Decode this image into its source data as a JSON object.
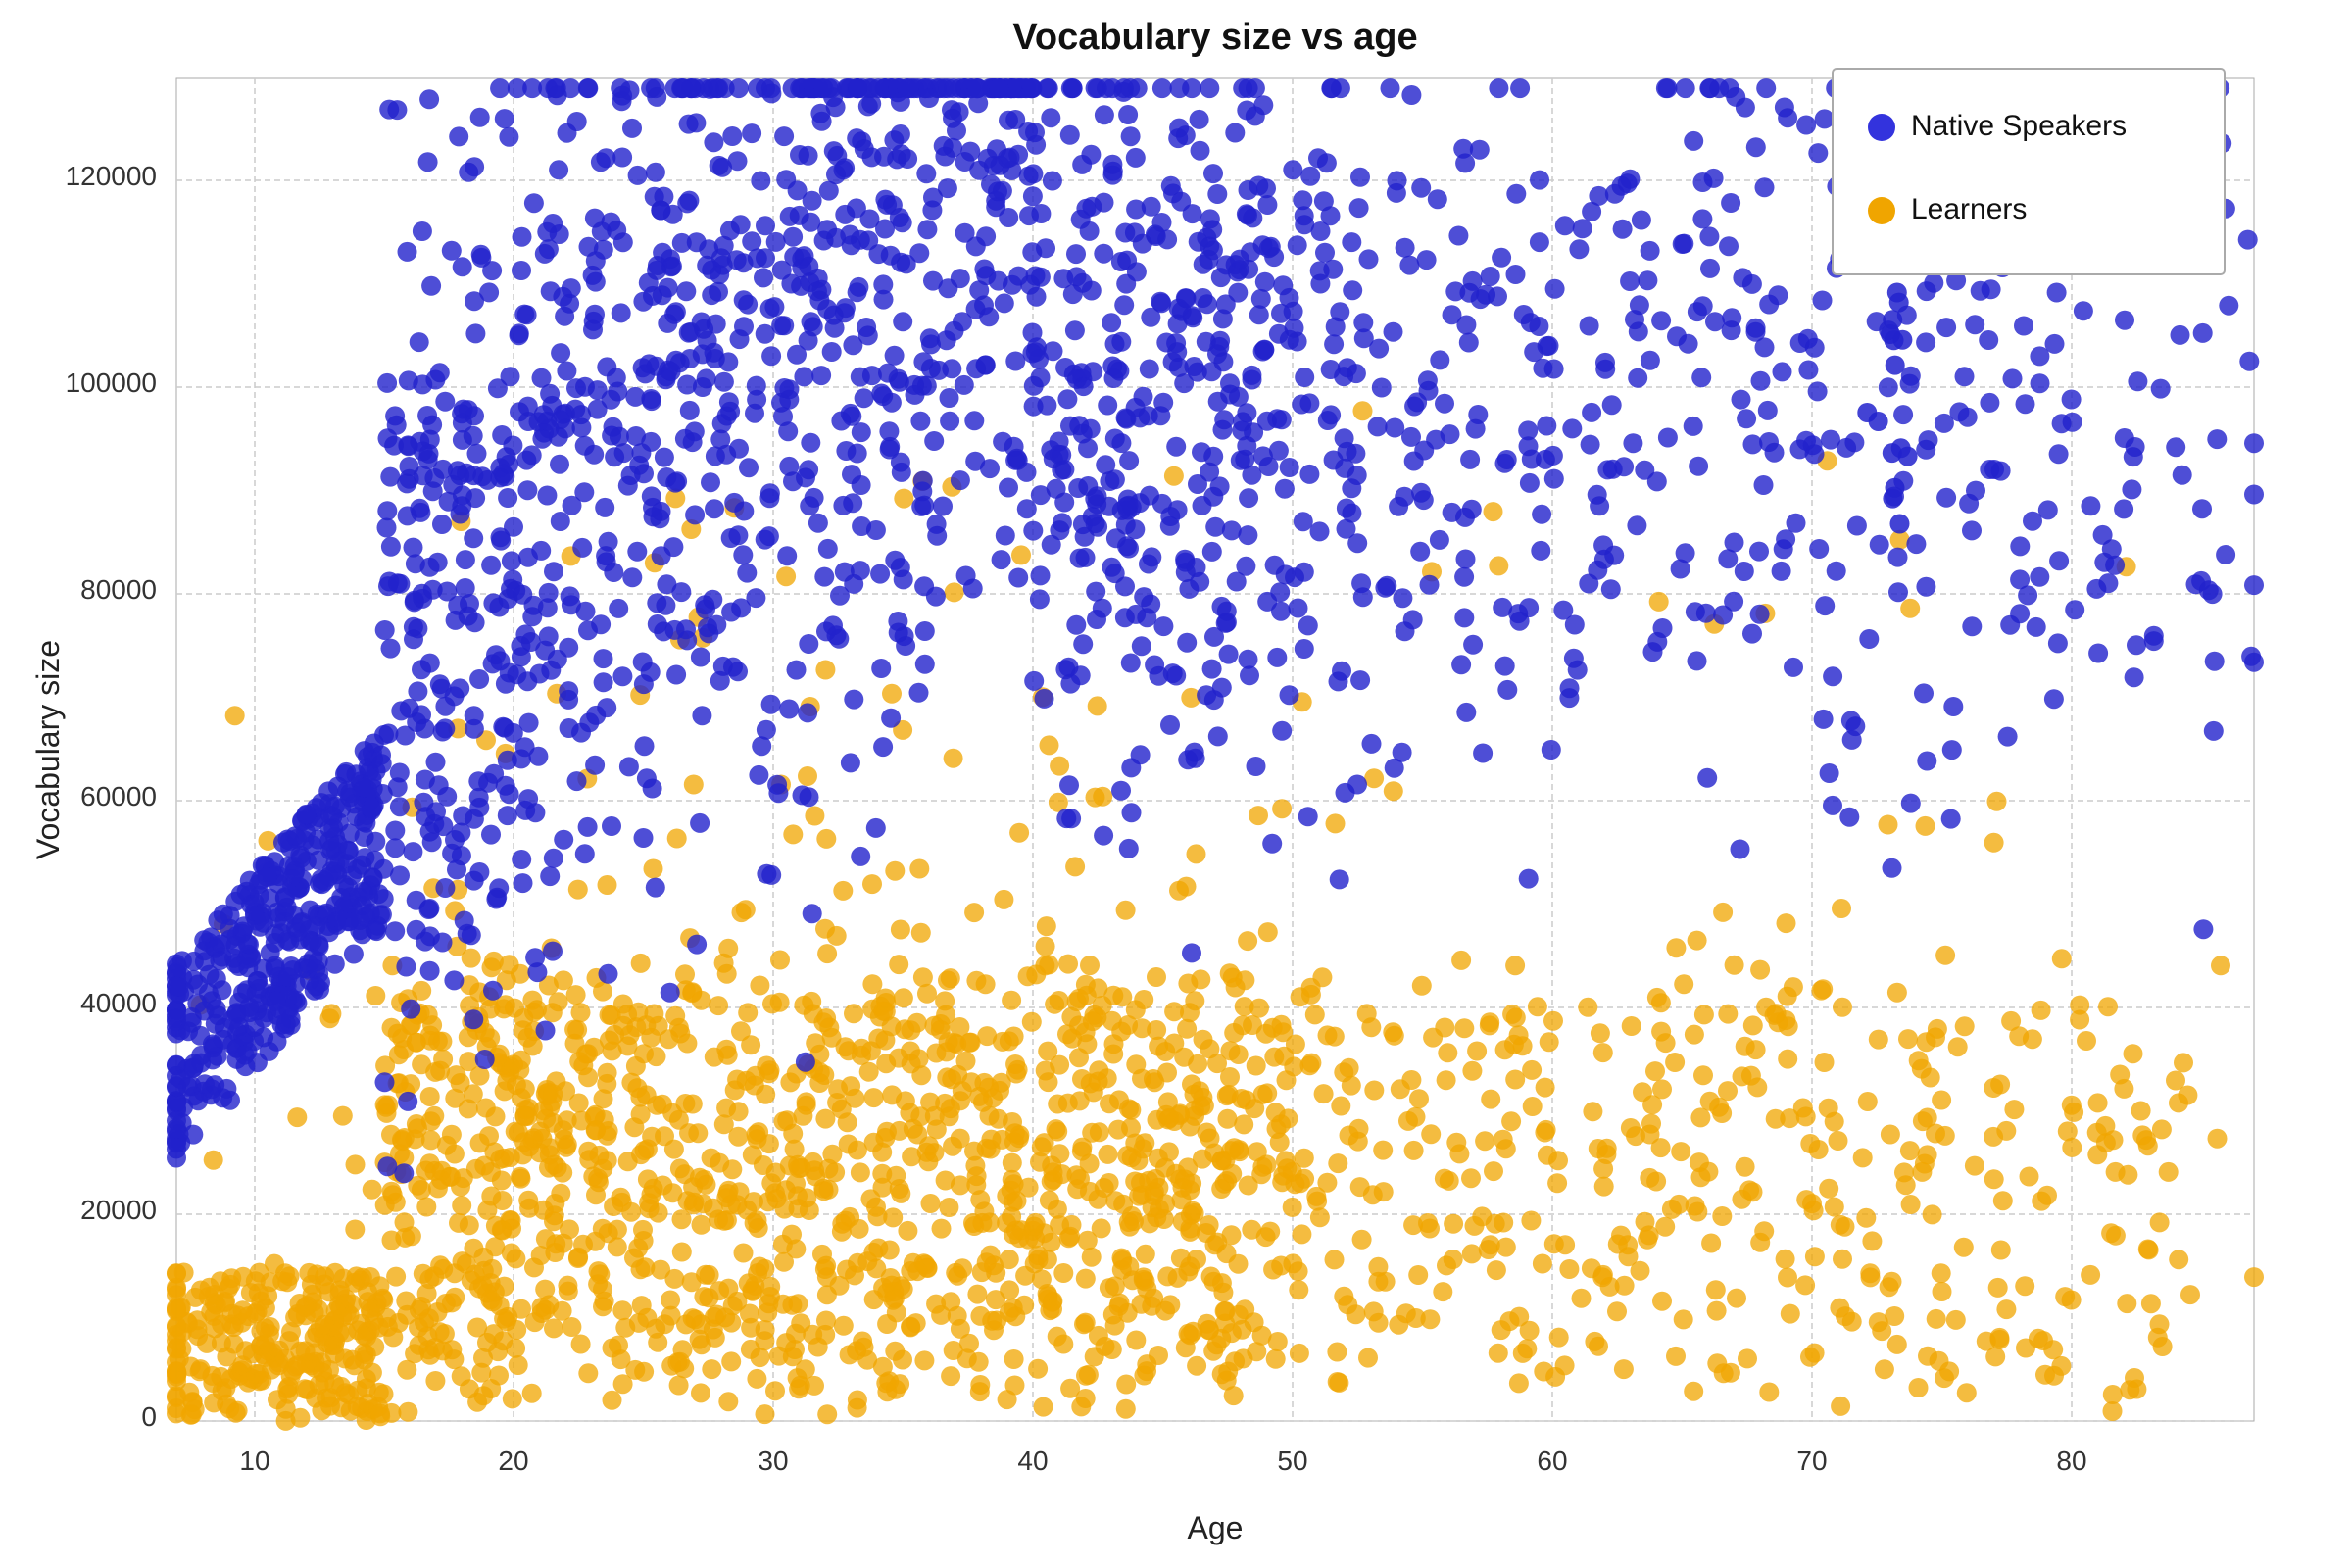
{
  "chart": {
    "title": "Vocabulary size vs age",
    "x_axis_label": "Age",
    "y_axis_label": "Vocabulary size",
    "legend": {
      "native_speakers_label": "Native Speakers",
      "learners_label": "Learners",
      "native_color": "#3333cc",
      "learner_color": "#f0a500"
    },
    "x_ticks": [
      10,
      20,
      30,
      40,
      50,
      60,
      70,
      80
    ],
    "y_ticks": [
      0,
      20000,
      40000,
      60000,
      80000,
      100000,
      120000
    ],
    "colors": {
      "native": "#3333dd",
      "learner": "#f0a500",
      "grid": "#cccccc"
    }
  }
}
